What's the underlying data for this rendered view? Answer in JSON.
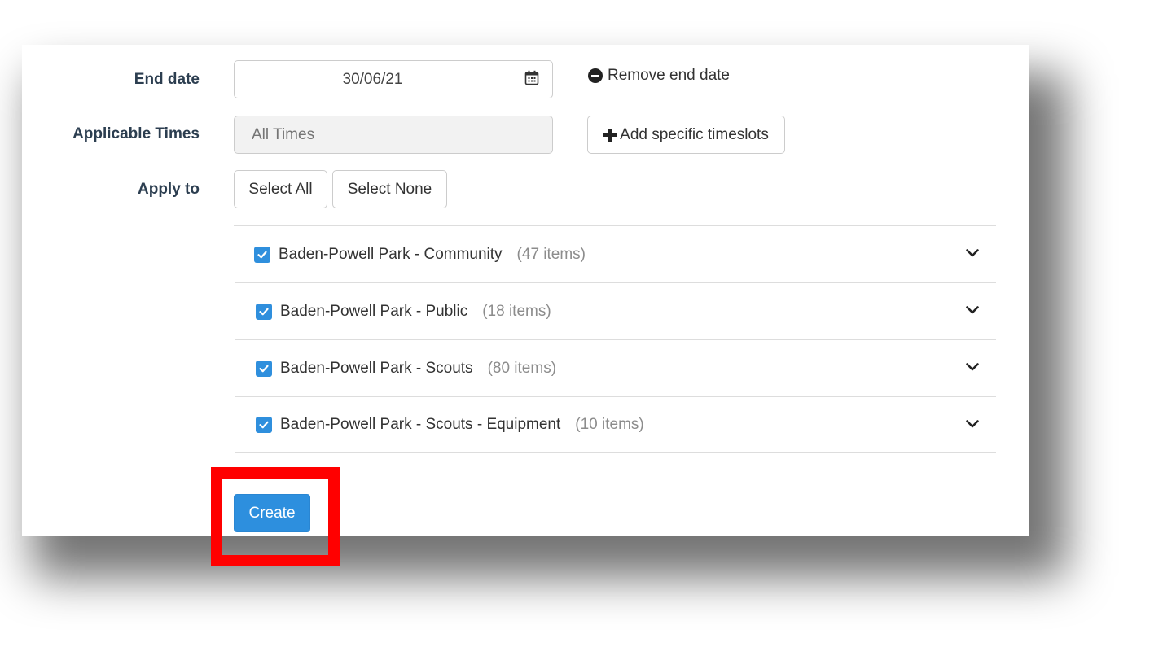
{
  "form": {
    "end_date": {
      "label": "End date",
      "value": "30/06/21",
      "remove_label": "Remove end date"
    },
    "applicable_times": {
      "label": "Applicable Times",
      "placeholder": "All Times",
      "add_label": "Add specific timeslots"
    },
    "apply_to": {
      "label": "Apply to",
      "select_all_label": "Select All",
      "select_none_label": "Select None"
    },
    "groups": [
      {
        "name": "Baden-Powell Park - Community",
        "count": "(47 items)",
        "checked": true
      },
      {
        "name": "Baden-Powell Park - Public",
        "count": "(18 items)",
        "checked": true
      },
      {
        "name": "Baden-Powell Park - Scouts",
        "count": "(80 items)",
        "checked": true
      },
      {
        "name": "Baden-Powell Park - Scouts - Equipment",
        "count": "(10 items)",
        "checked": true
      }
    ],
    "create_label": "Create"
  },
  "icons": {
    "calendar": "calendar-icon",
    "remove": "minus-circle-icon",
    "add": "plus-icon",
    "checkbox": "checkbox-checked-icon",
    "expand": "chevron-down-icon"
  },
  "colors": {
    "accent": "#2d8fde",
    "label": "#2c3e50",
    "highlight": "#ff0000"
  }
}
